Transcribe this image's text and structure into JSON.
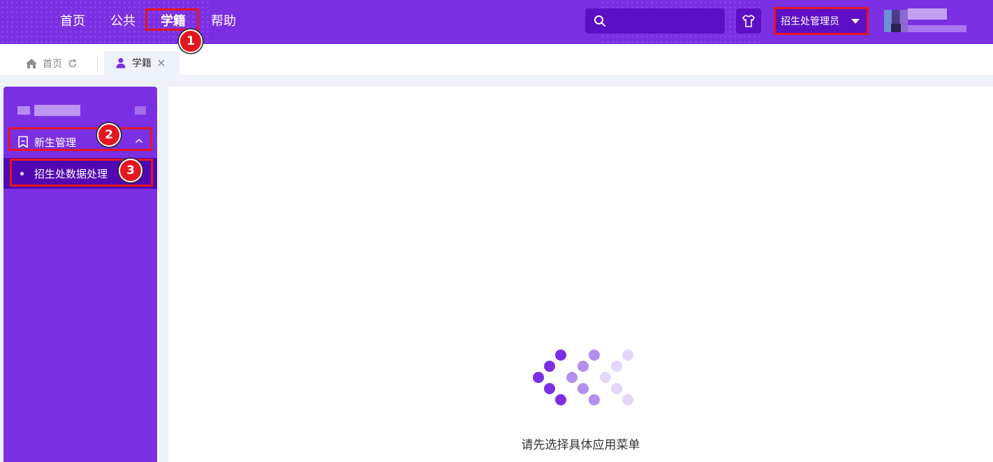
{
  "header": {
    "nav": [
      "首页",
      "公共",
      "学籍",
      "帮助"
    ],
    "active_nav_index": 2,
    "search_placeholder": "",
    "role_select": "招生处管理员"
  },
  "tabs": [
    {
      "label": "首页",
      "icon": "home-icon",
      "extra_icon": "refresh-icon"
    },
    {
      "label": "学籍",
      "icon": "user-icon",
      "extra_icon": "close-icon",
      "active": true
    }
  ],
  "sidebar": {
    "group_label": "新生管理",
    "group_icon": "bookmark-icon",
    "group_expanded": true,
    "items": [
      {
        "label": "招生处数据处理"
      }
    ]
  },
  "main": {
    "hint": "请先选择具体应用菜单"
  },
  "annotations": [
    "1",
    "2",
    "3"
  ],
  "colors": {
    "primary": "#7b2fe3",
    "primary_dark": "#5d0fc5",
    "submenu_active": "#5207b4",
    "marker_red": "#e4161e",
    "page_bg": "#eef2fb"
  }
}
